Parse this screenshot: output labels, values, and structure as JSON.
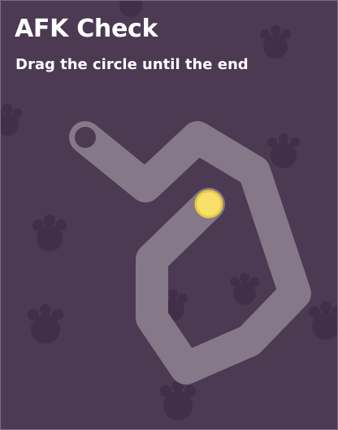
{
  "header": {
    "title": "AFK Check",
    "subtitle": "Drag the circle until the end"
  },
  "game": {
    "type": "drag-along-path",
    "path_color": "#857889",
    "start_marker_color": "#4b3a52",
    "handle_color": "#f8e06a",
    "handle_ring_color": "#e8c93f",
    "background_color": "#4b3a52",
    "background_pattern": "paw-prints",
    "paw_color": "#402f46"
  }
}
